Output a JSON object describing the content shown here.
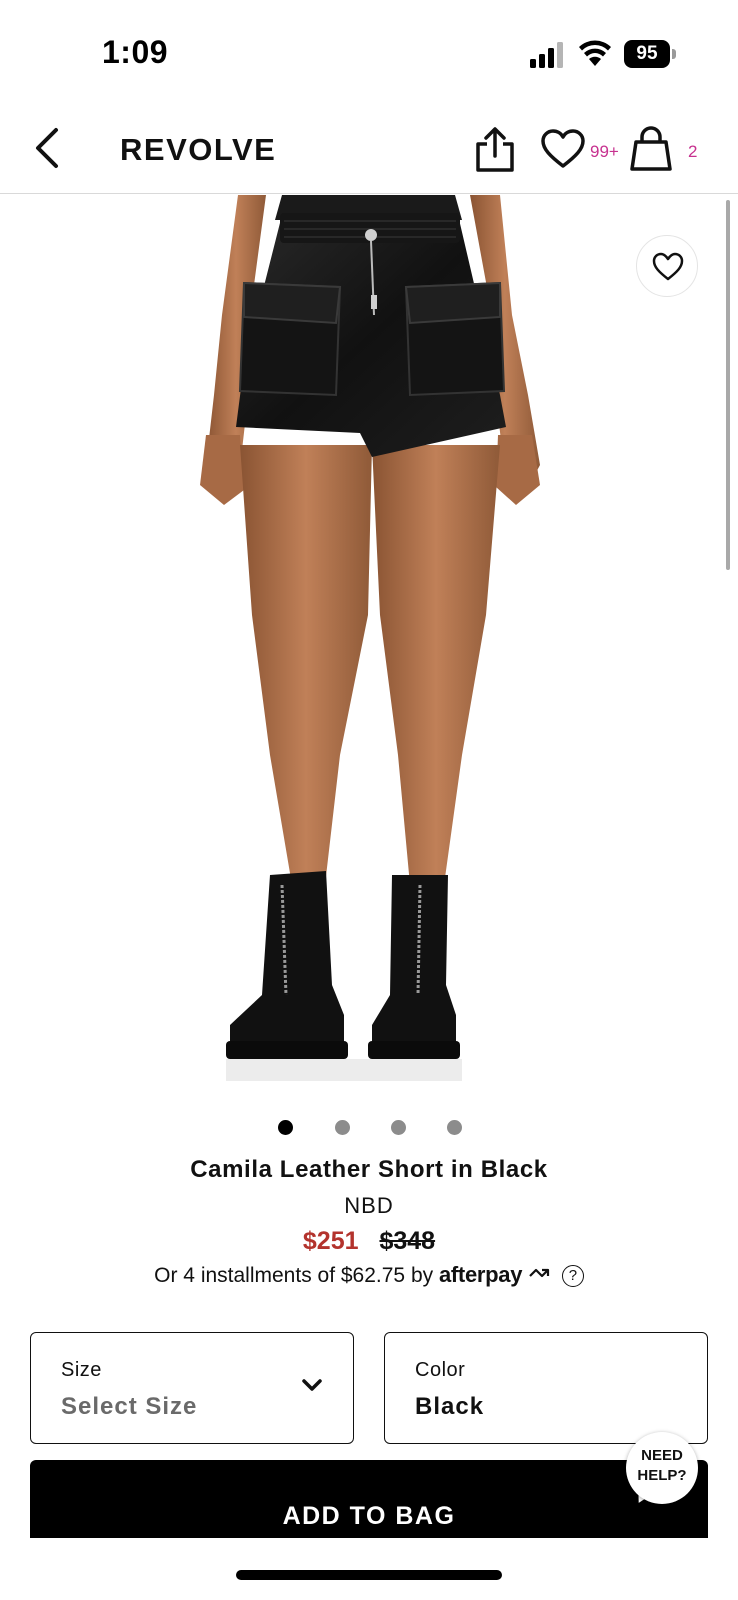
{
  "status_bar": {
    "time": "1:09",
    "battery": "95"
  },
  "header": {
    "logo": "REVOLVE",
    "wishlist_count": "99+",
    "bag_count": "2",
    "accent_color": "#c7318f",
    "icons": [
      "back-arrow-icon",
      "share-icon",
      "heart-icon",
      "shopping-bag-icon"
    ]
  },
  "gallery": {
    "image_alt": "Model wearing black leather shorts with cargo pockets and black zip boots",
    "total_images": 4,
    "active_index": 0
  },
  "product": {
    "title": "Camila Leather Short in Black",
    "brand": "NBD",
    "sale_price": "$251",
    "original_price": "$348",
    "sale_color": "#b3332d",
    "installments_text": "Or 4 installments of $62.75 by",
    "afterpay_label": "afterpay",
    "info_icon": "?"
  },
  "selectors": {
    "size": {
      "label": "Size",
      "value": "Select Size"
    },
    "color": {
      "label": "Color",
      "value": "Black"
    }
  },
  "actions": {
    "add_to_bag": "ADD TO BAG",
    "need_help_line1": "NEED",
    "need_help_line2": "HELP?"
  }
}
